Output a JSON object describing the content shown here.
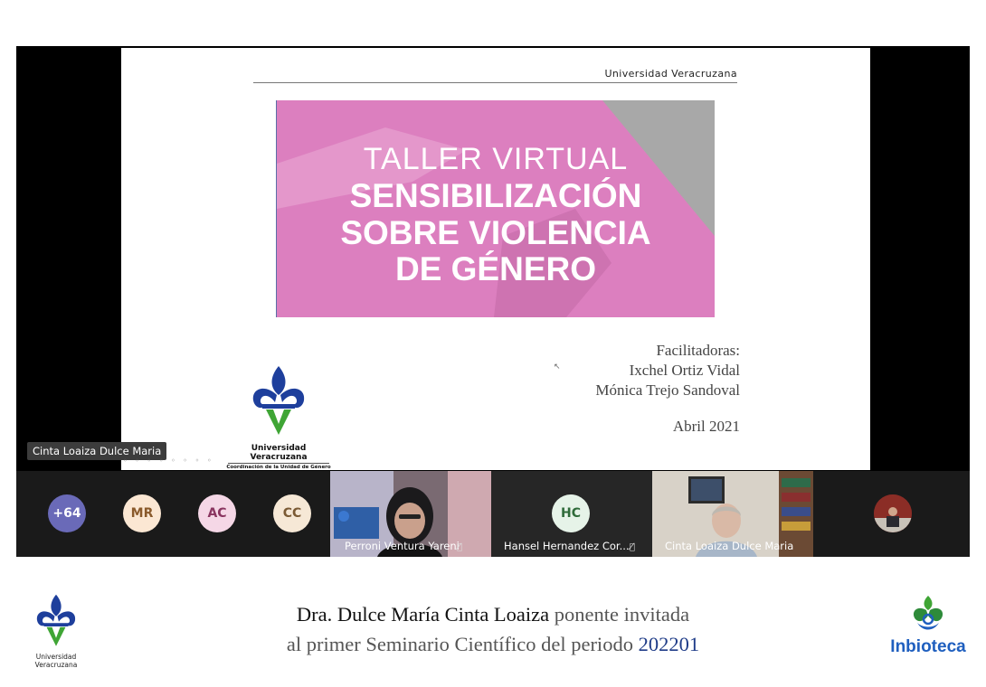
{
  "slide": {
    "header": "Universidad Veracruzana",
    "banner": {
      "line1": "TALLER VIRTUAL",
      "line2": "SENSIBILIZACIÓN",
      "line3": "SOBRE VIOLENCIA",
      "line4": "DE GÉNERO"
    },
    "facilitators_label": "Facilitadoras:",
    "facilitator_1": "Ixchel Ortiz Vidal",
    "facilitator_2": "Mónica Trejo Sandoval",
    "date": "Abril 2021",
    "logo_name": "Universidad Veracruzana",
    "logo_sub": "Coordinación de la Unidad de Género"
  },
  "active_speaker_label": "Cinta Loaiza Dulce Maria",
  "participants": {
    "more_count": "+64",
    "avatars": [
      {
        "initials": "MR",
        "bg": "#fbe7d3",
        "fg": "#8a5a2b"
      },
      {
        "initials": "AC",
        "bg": "#f5d7e6",
        "fg": "#8a3560"
      },
      {
        "initials": "CC",
        "bg": "#f6e8d6",
        "fg": "#7b5a34"
      }
    ],
    "more_bg": "#6a6ab8",
    "tiles": [
      {
        "name": "Perroni Ventura Yareni"
      },
      {
        "name": "Hansel Hernandez Cor...",
        "initials": "HC",
        "bg": "#e6f3e8",
        "fg": "#2f6b3a"
      },
      {
        "name": "Cinta Loaiza Dulce Maria"
      }
    ]
  },
  "caption": {
    "name": "Dra. Dulce María Cinta Loaiza",
    "rest1": " ponente invitada",
    "line2a": "al primer Seminario Científico del periodo ",
    "period": "202201"
  },
  "footer": {
    "uv_label": "Universidad Veracruzana",
    "inbioteca_label": "Inbioteca"
  },
  "colors": {
    "banner_pink": "#dc7fbf",
    "uv_blue": "#1e3f9c",
    "uv_green": "#3fa535",
    "caption_blue": "#1f3c88"
  }
}
